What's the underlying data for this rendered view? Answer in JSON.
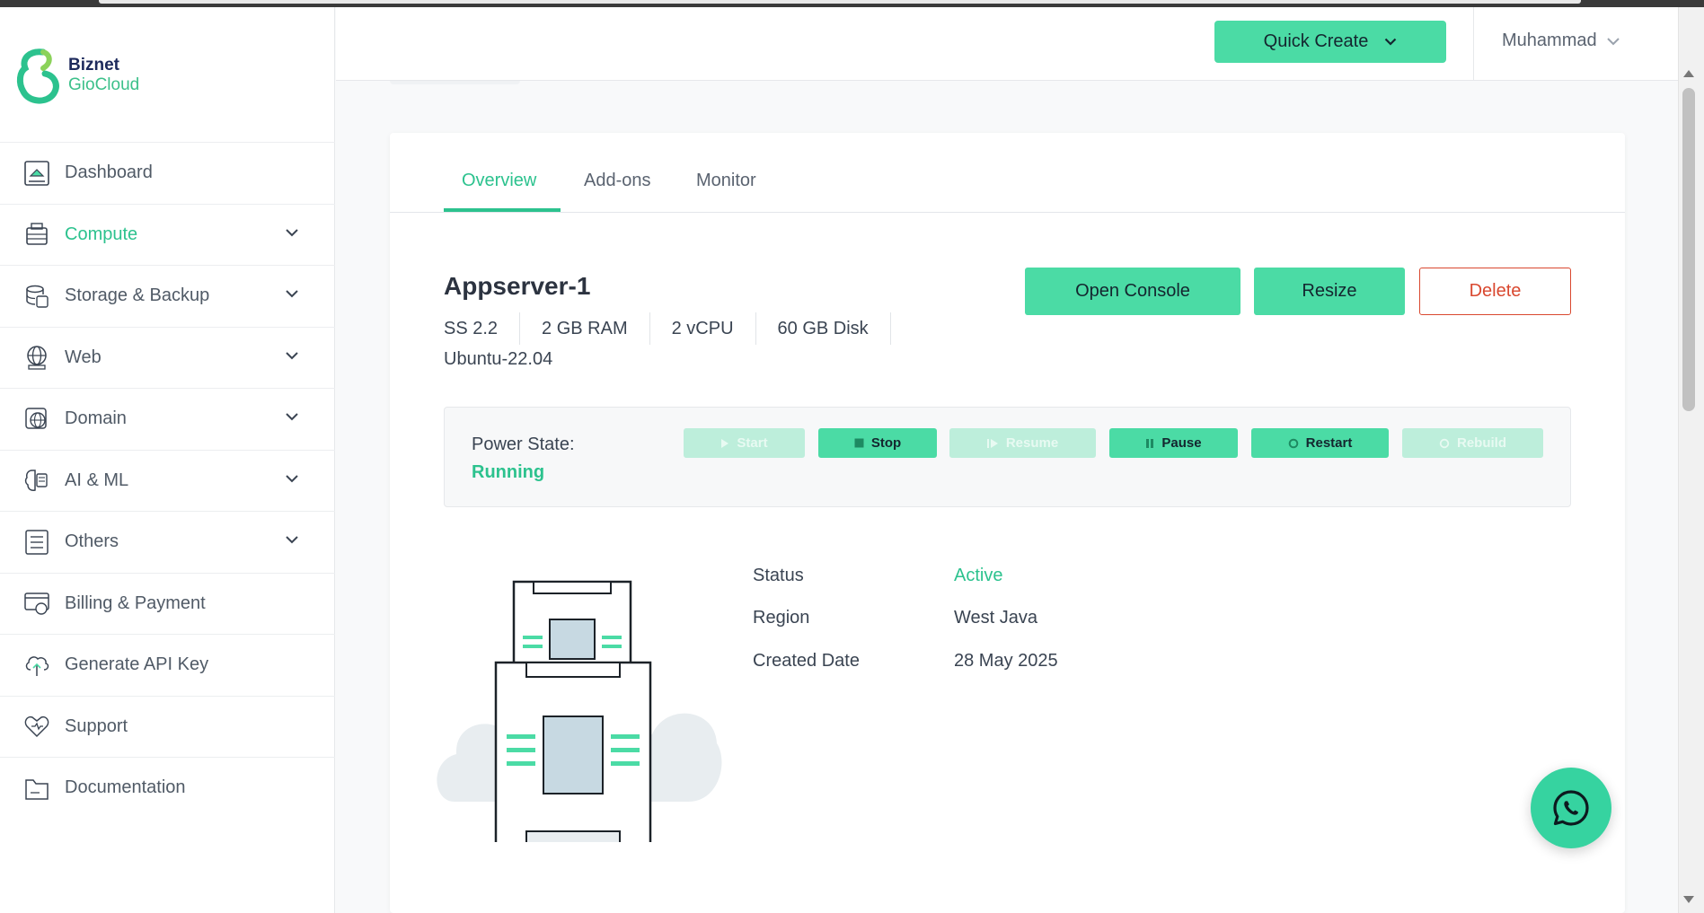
{
  "brand": {
    "line1": "Biznet",
    "line2": "GioCloud"
  },
  "colors": {
    "accent": "#2cc28e",
    "button": "#4bdba5",
    "danger": "#d9482f"
  },
  "sidebar": {
    "items": [
      {
        "label": "Dashboard",
        "icon": "dashboard-icon",
        "expandable": false
      },
      {
        "label": "Compute",
        "icon": "compute-icon",
        "expandable": true,
        "active": true
      },
      {
        "label": "Storage & Backup",
        "icon": "storage-icon",
        "expandable": true
      },
      {
        "label": "Web",
        "icon": "web-icon",
        "expandable": true
      },
      {
        "label": "Domain",
        "icon": "domain-icon",
        "expandable": true
      },
      {
        "label": "AI & ML",
        "icon": "ai-ml-icon",
        "expandable": true
      },
      {
        "label": "Others",
        "icon": "others-icon",
        "expandable": true
      },
      {
        "label": "Billing & Payment",
        "icon": "billing-icon",
        "expandable": false
      },
      {
        "label": "Generate API Key",
        "icon": "api-key-icon",
        "expandable": false
      },
      {
        "label": "Support",
        "icon": "support-icon",
        "expandable": false
      },
      {
        "label": "Documentation",
        "icon": "documentation-icon",
        "expandable": false
      }
    ]
  },
  "header": {
    "quick_create": "Quick Create",
    "user": "Muhammad"
  },
  "tabs": [
    {
      "label": "Overview",
      "active": true
    },
    {
      "label": "Add-ons",
      "active": false
    },
    {
      "label": "Monitor",
      "active": false
    }
  ],
  "server": {
    "name": "Appserver-1",
    "specs": [
      "SS 2.2",
      "2 GB RAM",
      "2 vCPU",
      "60 GB Disk"
    ],
    "os": "Ubuntu-22.04"
  },
  "actions": {
    "open_console": "Open Console",
    "resize": "Resize",
    "delete": "Delete"
  },
  "power": {
    "label": "Power State:",
    "state": "Running",
    "buttons": [
      {
        "label": "Start",
        "icon": "play-icon",
        "enabled": false
      },
      {
        "label": "Stop",
        "icon": "stop-icon",
        "enabled": true
      },
      {
        "label": "Resume",
        "icon": "resume-icon",
        "enabled": false
      },
      {
        "label": "Pause",
        "icon": "pause-icon",
        "enabled": true
      },
      {
        "label": "Restart",
        "icon": "restart-icon",
        "enabled": true
      },
      {
        "label": "Rebuild",
        "icon": "rebuild-icon",
        "enabled": false
      }
    ]
  },
  "info": [
    {
      "label": "Status",
      "value": "Active",
      "highlight": true
    },
    {
      "label": "Region",
      "value": "West Java",
      "highlight": false
    },
    {
      "label": "Created Date",
      "value": "28 May 2025",
      "highlight": false
    }
  ]
}
